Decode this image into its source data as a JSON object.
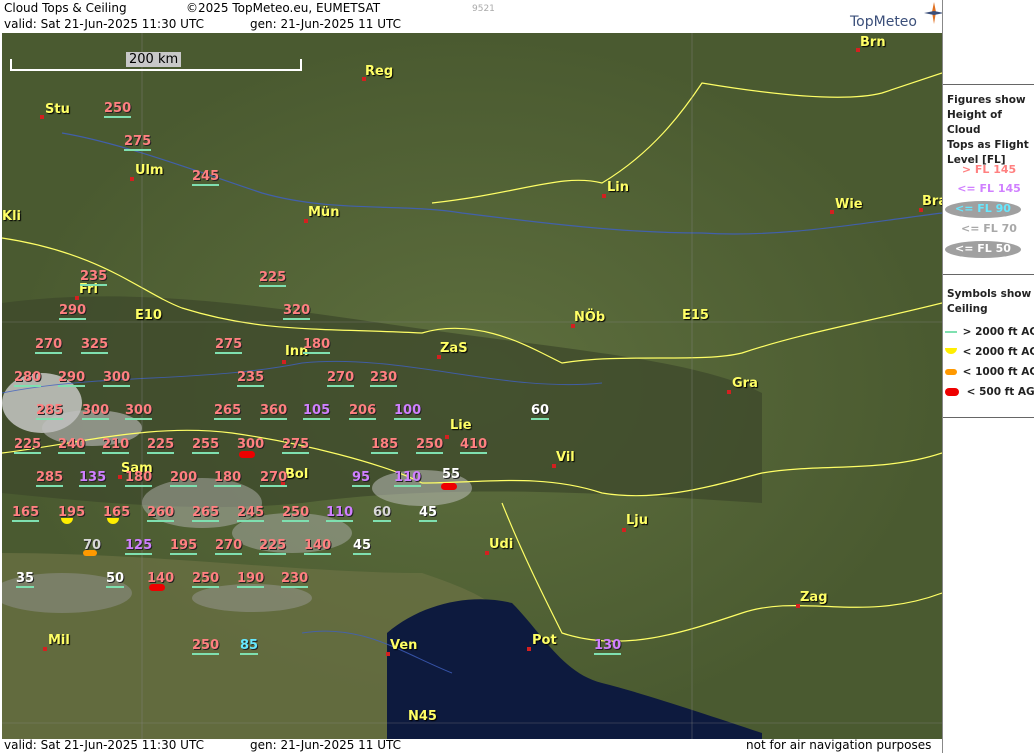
{
  "header": {
    "title": "Cloud Tops & Ceiling",
    "copyright": "©2025 TopMeteo.eu, EUMETSAT",
    "code": "9521",
    "valid": "valid:  Sat  21-Jun-2025  11:30 UTC",
    "gen": "gen: 21-Jun-2025 11 UTC",
    "logo": "TopMeteo"
  },
  "footer": {
    "valid": "valid:  Sat  21-Jun-2025  11:30 UTC",
    "gen": "gen: 21-Jun-2025 11 UTC",
    "disclaimer": "not for air navigation purposes"
  },
  "scale": {
    "label": "200 km"
  },
  "grid_labels": [
    "E10",
    "E15",
    "N45"
  ],
  "cities": [
    "Brn",
    "Reg",
    "Stu",
    "Ulm",
    "Lin",
    "Wie",
    "Bra",
    "Mün",
    "Kli",
    "Fri",
    "NÖb",
    "ZaS",
    "Inn",
    "Gra",
    "Lie",
    "Sam",
    "Bol",
    "Vil",
    "Lju",
    "Udi",
    "Zag",
    "Mil",
    "Ven",
    "Pot"
  ],
  "flight_levels": [
    {
      "v": "250",
      "c": "pink"
    },
    {
      "v": "275",
      "c": "pink"
    },
    {
      "v": "245",
      "c": "pink"
    },
    {
      "v": "235",
      "c": "pink"
    },
    {
      "v": "225",
      "c": "pink"
    },
    {
      "v": "290",
      "c": "pink"
    },
    {
      "v": "320",
      "c": "pink"
    },
    {
      "v": "270",
      "c": "pink"
    },
    {
      "v": "325",
      "c": "pink"
    },
    {
      "v": "275",
      "c": "pink"
    },
    {
      "v": "180",
      "c": "pink"
    },
    {
      "v": "280",
      "c": "pink"
    },
    {
      "v": "290",
      "c": "pink"
    },
    {
      "v": "300",
      "c": "pink"
    },
    {
      "v": "235",
      "c": "pink"
    },
    {
      "v": "270",
      "c": "pink"
    },
    {
      "v": "230",
      "c": "pink"
    },
    {
      "v": "285",
      "c": "pink"
    },
    {
      "v": "300",
      "c": "pink"
    },
    {
      "v": "300",
      "c": "pink"
    },
    {
      "v": "265",
      "c": "pink"
    },
    {
      "v": "360",
      "c": "pink"
    },
    {
      "v": "105",
      "c": "violet"
    },
    {
      "v": "206",
      "c": "pink"
    },
    {
      "v": "100",
      "c": "violet"
    },
    {
      "v": "60",
      "c": "white"
    },
    {
      "v": "225",
      "c": "pink"
    },
    {
      "v": "240",
      "c": "pink"
    },
    {
      "v": "210",
      "c": "pink"
    },
    {
      "v": "225",
      "c": "pink"
    },
    {
      "v": "255",
      "c": "pink"
    },
    {
      "v": "300",
      "c": "pink"
    },
    {
      "v": "275",
      "c": "pink"
    },
    {
      "v": "185",
      "c": "pink"
    },
    {
      "v": "250",
      "c": "pink"
    },
    {
      "v": "410",
      "c": "pink"
    },
    {
      "v": "285",
      "c": "pink"
    },
    {
      "v": "135",
      "c": "violet"
    },
    {
      "v": "180",
      "c": "pink"
    },
    {
      "v": "200",
      "c": "pink"
    },
    {
      "v": "180",
      "c": "pink"
    },
    {
      "v": "270",
      "c": "pink"
    },
    {
      "v": "95",
      "c": "violet"
    },
    {
      "v": "110",
      "c": "violet"
    },
    {
      "v": "55",
      "c": "white"
    },
    {
      "v": "165",
      "c": "pink"
    },
    {
      "v": "195",
      "c": "pink"
    },
    {
      "v": "165",
      "c": "pink"
    },
    {
      "v": "260",
      "c": "pink"
    },
    {
      "v": "265",
      "c": "pink"
    },
    {
      "v": "245",
      "c": "pink"
    },
    {
      "v": "250",
      "c": "pink"
    },
    {
      "v": "110",
      "c": "violet"
    },
    {
      "v": "60",
      "c": "grey"
    },
    {
      "v": "45",
      "c": "white"
    },
    {
      "v": "70",
      "c": "grey"
    },
    {
      "v": "125",
      "c": "violet"
    },
    {
      "v": "195",
      "c": "pink"
    },
    {
      "v": "270",
      "c": "pink"
    },
    {
      "v": "225",
      "c": "pink"
    },
    {
      "v": "140",
      "c": "pink"
    },
    {
      "v": "45",
      "c": "white"
    },
    {
      "v": "35",
      "c": "white"
    },
    {
      "v": "50",
      "c": "white"
    },
    {
      "v": "140",
      "c": "pink"
    },
    {
      "v": "250",
      "c": "pink"
    },
    {
      "v": "190",
      "c": "pink"
    },
    {
      "v": "230",
      "c": "pink"
    },
    {
      "v": "250",
      "c": "pink"
    },
    {
      "v": "85",
      "c": "cyan"
    },
    {
      "v": "130",
      "c": "violet"
    }
  ],
  "panel": {
    "intro": [
      "Figures show",
      "Height of Cloud",
      "Tops as Flight",
      "Level  [FL]"
    ],
    "levels": [
      {
        "label": "> FL 145",
        "color": "#ff8080",
        "oval": false
      },
      {
        "label": "<= FL 145",
        "color": "#d080ff",
        "oval": false
      },
      {
        "label": "<= FL 90",
        "color": "#66e8ff",
        "oval": true
      },
      {
        "label": "<= FL 70",
        "color": "#a8a8a8",
        "oval": false
      },
      {
        "label": "<= FL 50",
        "color": "#ffffff",
        "oval": true
      }
    ],
    "symbols_title": [
      "Symbols show",
      "Ceiling"
    ],
    "symbols": [
      {
        "label": "> 2000 ft AGL",
        "type": "line",
        "color": "#7fe0b0"
      },
      {
        "label": "< 2000 ft AGL",
        "type": "half",
        "color": "#ffee00"
      },
      {
        "label": "< 1000 ft AGL",
        "type": "bar",
        "color": "#ff9900"
      },
      {
        "label": "< 500 ft AGL",
        "type": "bar",
        "color": "#ee0000"
      }
    ]
  },
  "colors": {
    "pink": "#ff8080",
    "violet": "#d080ff",
    "cyan": "#66e8ff",
    "grey": "#d8d8d8",
    "white": "#ffffff",
    "city": "#ffff66"
  }
}
